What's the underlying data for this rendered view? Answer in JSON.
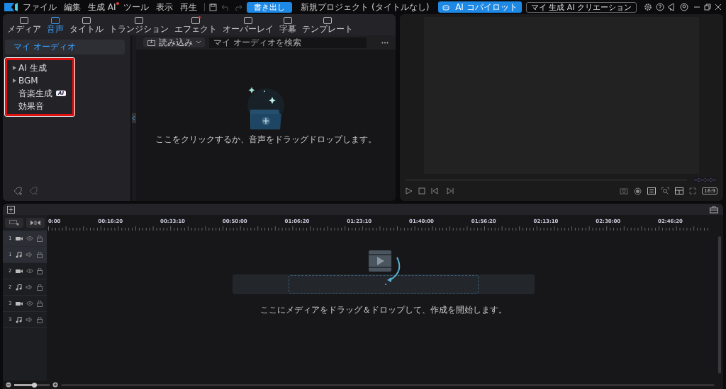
{
  "menu": [
    {
      "label": "ファイル",
      "dot": false
    },
    {
      "label": "編集",
      "dot": false
    },
    {
      "label": "生成 AI",
      "dot": true
    },
    {
      "label": "ツール",
      "dot": false
    },
    {
      "label": "表示",
      "dot": false
    },
    {
      "label": "再生",
      "dot": false
    }
  ],
  "export_button": "書き出し",
  "window": {
    "title": "新規プロジェクト (タイトルなし)"
  },
  "copilot_button": "AI コパイロット",
  "creations_button": "マイ 生成 AI クリエーション",
  "tabs": [
    {
      "label": "メディア",
      "selected": false,
      "dot": false
    },
    {
      "label": "音声",
      "selected": true,
      "dot": false
    },
    {
      "label": "タイトル",
      "selected": false,
      "dot": false
    },
    {
      "label": "トランジション",
      "selected": false,
      "dot": false
    },
    {
      "label": "エフェクト",
      "selected": false,
      "dot": true
    },
    {
      "label": "オーバーレイ",
      "selected": false,
      "dot": false
    },
    {
      "label": "字幕",
      "selected": false,
      "dot": false
    },
    {
      "label": "テンプレート",
      "selected": false,
      "dot": false
    }
  ],
  "sidebar": {
    "header": {
      "label": "マイ オーディオ",
      "selected": true
    },
    "items": [
      {
        "label": "AI 生成",
        "kind": "folder",
        "expanded": false,
        "selected": false
      },
      {
        "label": "BGM",
        "kind": "folder",
        "expanded": false,
        "selected": false
      },
      {
        "label": "音楽生成",
        "kind": "leaf",
        "badge": "AI",
        "selected": false
      },
      {
        "label": "効果音",
        "kind": "leaf",
        "selected": false
      }
    ]
  },
  "import_button": "読み込み",
  "search": {
    "placeholder": "マイ オーディオを検索"
  },
  "media_empty_text": "ここをクリックするか、音声をドラッグドロップします。",
  "preview": {
    "timecode": "--:--:--:--",
    "aspect": "16:9"
  },
  "ruler": [
    "0:00",
    "00:16:20",
    "00:33:10",
    "00:50:00",
    "01:06:20",
    "01:23:10",
    "01:40:00",
    "01:56:20",
    "02:13:10",
    "02:30:00",
    "02:46:20"
  ],
  "tracks": [
    {
      "number": "1",
      "kind": "video",
      "selected": true
    },
    {
      "number": "1",
      "kind": "audio",
      "selected": true
    },
    {
      "number": "2",
      "kind": "video",
      "selected": false
    },
    {
      "number": "2",
      "kind": "audio",
      "selected": false
    },
    {
      "number": "3",
      "kind": "video",
      "selected": false
    },
    {
      "number": "3",
      "kind": "audio",
      "selected": false
    }
  ],
  "timeline_empty_text": "ここにメディアをドラッグ＆ドロップして、作成を開始します。",
  "zoom_slider": {
    "level": 0.55
  }
}
